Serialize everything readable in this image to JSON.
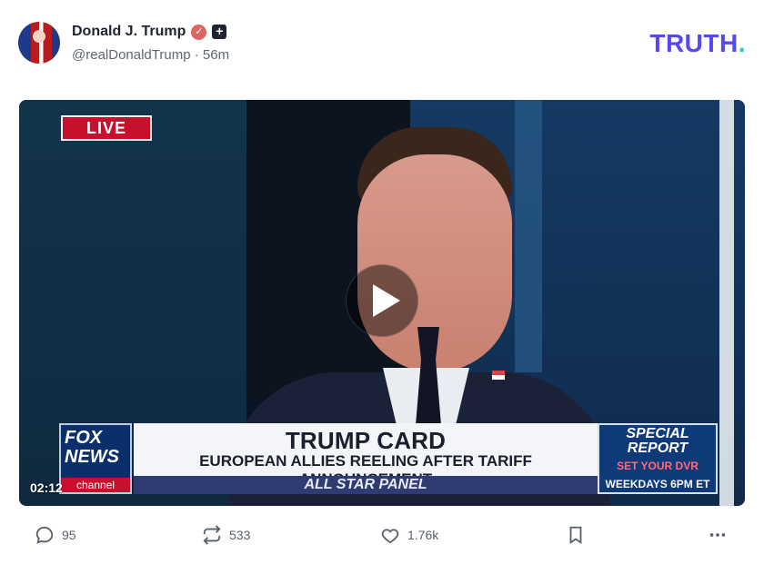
{
  "post": {
    "author": {
      "display_name": "Donald J. Trump",
      "handle": "@realDonaldTrump",
      "time_ago": "56m"
    },
    "brand": {
      "logo_text": "TRUTH",
      "logo_dot": "."
    },
    "video": {
      "live_badge": "LIVE",
      "duration": "02:12",
      "lower_third": {
        "network_top": "FOX",
        "network_bottom": "NEWS",
        "network_channel": "channel",
        "headline": "TRUMP CARD",
        "subheadline": "EUROPEAN ALLIES REELING AFTER TARIFF ANNOUNCEMENT",
        "panel": "ALL STAR PANEL",
        "special_title_line1": "SPECIAL",
        "special_title_line2": "REPORT",
        "special_subtitle": "SET YOUR DVR",
        "special_time": "WEEKDAYS 6PM ET"
      }
    },
    "actions": {
      "replies": "95",
      "retruths": "533",
      "likes": "1.76k"
    }
  }
}
